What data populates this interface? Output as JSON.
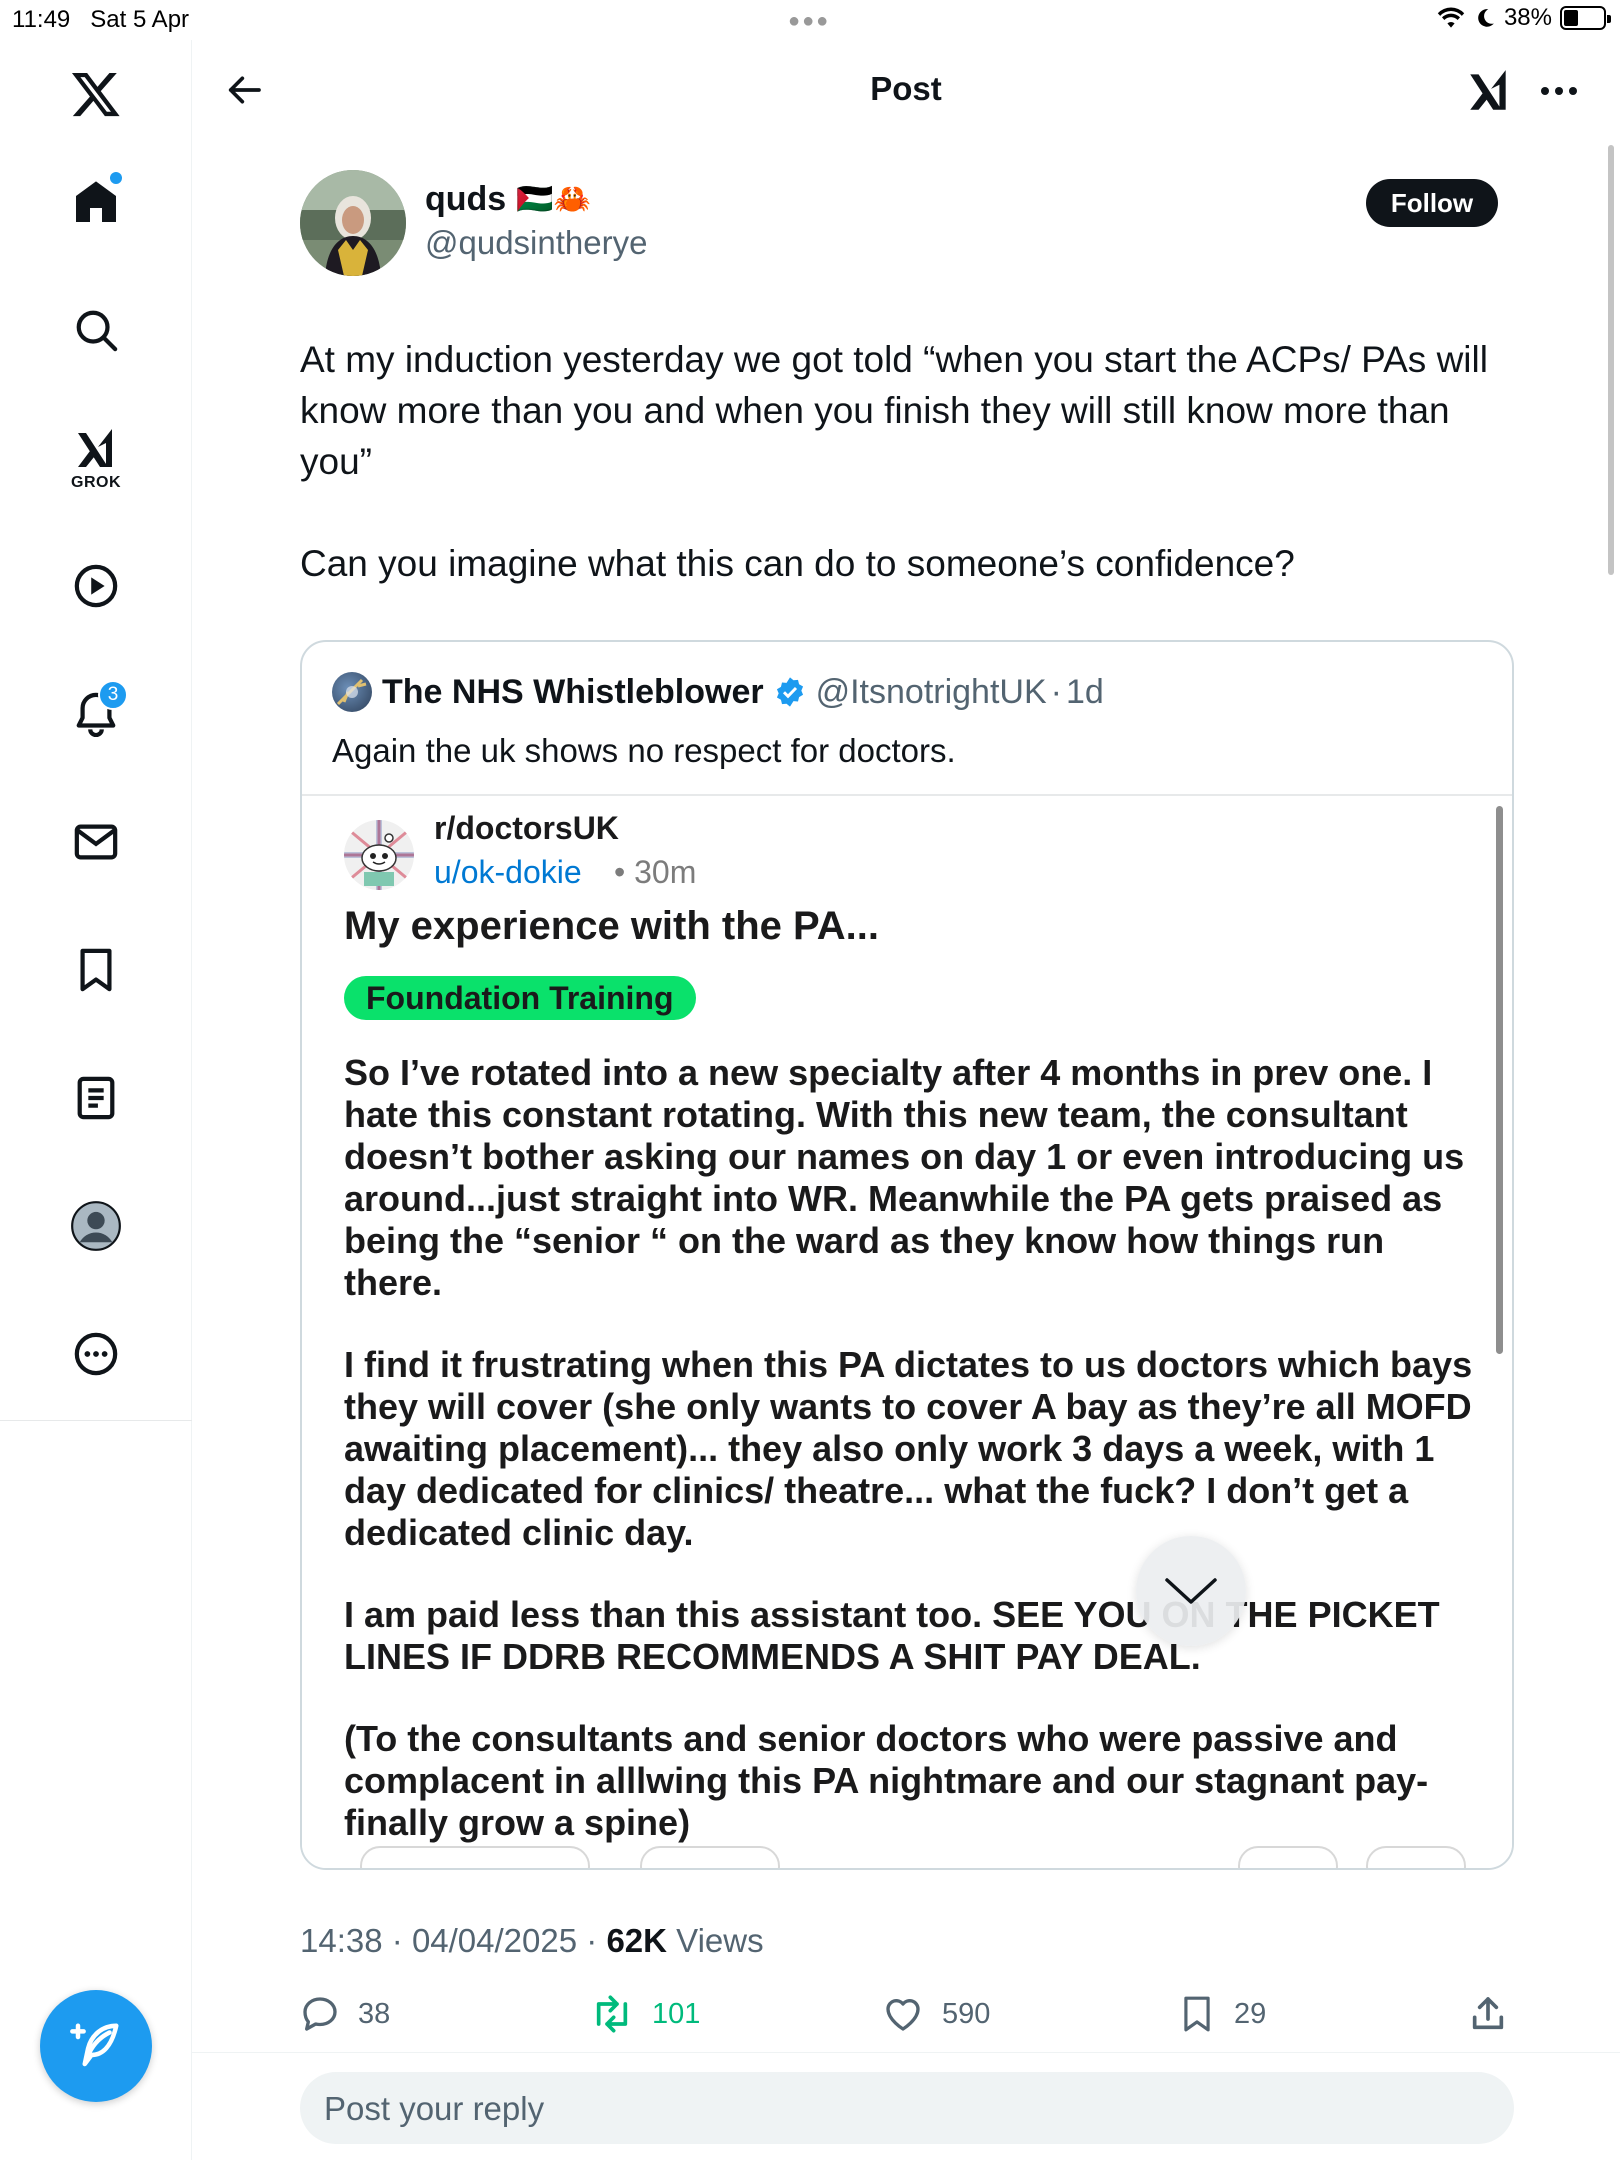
{
  "status": {
    "time": "11:49",
    "date": "Sat 5 Apr",
    "battery": "38%",
    "battery_level": 0.38
  },
  "nav": {
    "grok_label": "GROK",
    "notifications_badge": "3"
  },
  "header": {
    "title": "Post"
  },
  "tweet": {
    "author_name": "quds",
    "author_emojis": "🇵🇸🦀",
    "author_handle": "@qudsintherye",
    "follow_label": "Follow",
    "paragraphs": [
      "At my induction yesterday we got told “when you start the ACPs/ PAs will know more than you and when you finish they will still know more than you”",
      "Can you imagine what this can do to someone’s confidence?"
    ],
    "time": "14:38",
    "date": "04/04/2025",
    "views_count": "62K",
    "views_label": "Views",
    "separator": "·"
  },
  "quote": {
    "name": "The NHS Whistleblower",
    "handle": "@ItsnotrightUK",
    "age": "1d",
    "separator": "·",
    "text": "Again the uk shows no respect for doctors.",
    "reddit": {
      "subreddit": "r/doctorsUK",
      "user": "u/ok-dokie",
      "time": "• 30m",
      "title": "My experience with the PA...",
      "flair": "Foundation Training",
      "paragraphs": [
        "So I’ve rotated into a new specialty after 4 months in prev one. I hate this constant rotating. With this new team, the consultant doesn’t bother asking our names on day 1 or even introducing us around...just straight into WR. Meanwhile the PA gets praised as being the “senior “ on the ward as they know how things run there.",
        "I find it frustrating when this PA dictates to us doctors which bays they will cover (she only wants to cover A bay as they’re all MOFD awaiting placement)... they also only work 3 days a week, with 1 day dedicated for clinics/ theatre... what the fuck? I don’t get a dedicated clinic day.",
        "I am paid less than this assistant too. SEE YOU ON THE PICKET LINES IF DDRB RECOMMENDS A SHIT PAY DEAL.",
        "(To the consultants and senior doctors who were passive and complacent in alllwing this PA nightmare and our stagnant pay- finally grow a spine)"
      ]
    }
  },
  "actions": {
    "replies": "38",
    "reposts": "101",
    "likes": "590",
    "bookmarks": "29"
  },
  "reply": {
    "placeholder": "Post your reply"
  },
  "colors": {
    "accent": "#1d9bf0",
    "repost": "#00ba7c",
    "flair": "#0ae16b",
    "reddit_user": "#0079d3"
  },
  "icons": [
    "x-logo-icon",
    "home-icon",
    "search-icon",
    "grok-icon",
    "video-icon",
    "bell-icon",
    "mail-icon",
    "bookmark-icon",
    "lists-icon",
    "profile-icon",
    "more-icon",
    "compose-icon",
    "back-arrow-icon",
    "ellipsis-icon",
    "verified-icon",
    "reply-icon",
    "repost-icon",
    "like-icon",
    "share-icon",
    "chevron-down-icon"
  ]
}
